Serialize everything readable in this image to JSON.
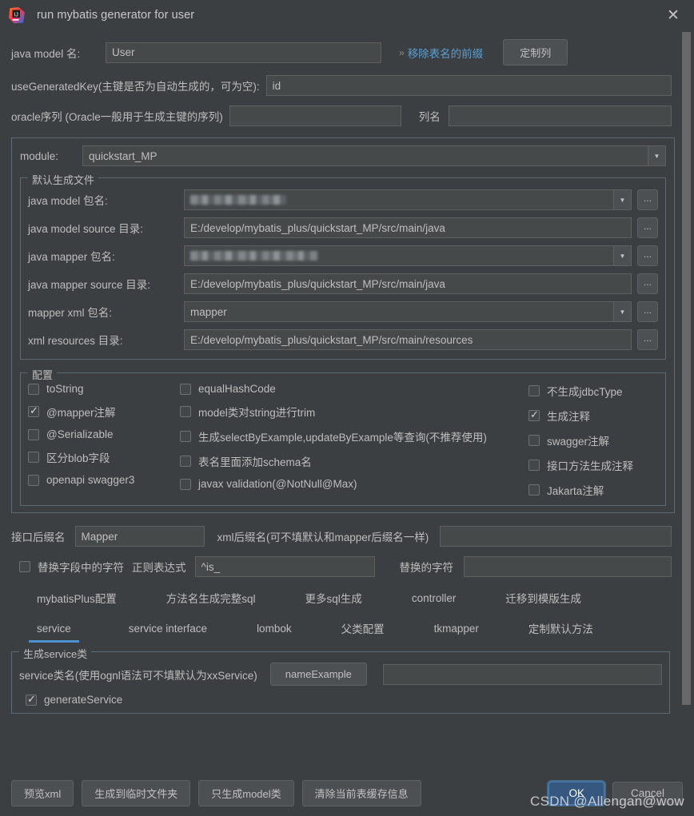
{
  "window": {
    "title": "run mybatis generator for user",
    "logo_icon": "intellij-idea-logo",
    "close_icon": "close-icon"
  },
  "form": {
    "java_model_label": "java model 名:",
    "java_model_value": "User",
    "remove_prefix_link": "移除表名的前缀",
    "chevron": "»",
    "custom_column_button": "定制列",
    "use_generated_key_label": "useGeneratedKey(主键是否为自动生成的，可为空):",
    "use_generated_key_value": "id",
    "oracle_seq_label": "oracle序列 (Oracle一般用于生成主键的序列)",
    "oracle_seq_value": "",
    "column_name_label": "列名",
    "column_name_value": "",
    "module_label": "module:",
    "module_value": "quickstart_MP"
  },
  "default_files_panel": {
    "title": "默认生成文件",
    "rows": [
      {
        "label": "java model 包名:",
        "value": "",
        "redacted": true,
        "type": "combo",
        "browse": "..."
      },
      {
        "label": "java model source 目录:",
        "value": "E:/develop/mybatis_plus/quickstart_MP/src/main/java",
        "redacted": false,
        "type": "text",
        "browse": "..."
      },
      {
        "label": "java mapper 包名:",
        "value": "",
        "redacted": true,
        "type": "combo",
        "browse": "..."
      },
      {
        "label": "java mapper source 目录:",
        "value": "E:/develop/mybatis_plus/quickstart_MP/src/main/java",
        "redacted": false,
        "type": "text",
        "browse": "..."
      },
      {
        "label": "mapper xml 包名:",
        "value": "mapper",
        "redacted": false,
        "type": "combo",
        "browse": "..."
      },
      {
        "label": "xml resources 目录:",
        "value": "E:/develop/mybatis_plus/quickstart_MP/src/main/resources",
        "redacted": false,
        "type": "text",
        "browse": "..."
      }
    ]
  },
  "config_panel": {
    "title": "配置",
    "column1": [
      {
        "label": "toString",
        "checked": false
      },
      {
        "label": "@mapper注解",
        "checked": true
      },
      {
        "label": "@Serializable",
        "checked": false
      },
      {
        "label": "区分blob字段",
        "checked": false
      },
      {
        "label": "openapi swagger3",
        "checked": false
      }
    ],
    "column2": [
      {
        "label": "equalHashCode",
        "checked": false
      },
      {
        "label": "model类对string进行trim",
        "checked": false
      },
      {
        "label": "生成selectByExample,updateByExample等查询(不推荐使用)",
        "checked": false
      },
      {
        "label": "表名里面添加schema名",
        "checked": false
      },
      {
        "label": "javax validation(@NotNull@Max)",
        "checked": false
      }
    ],
    "column3": [
      {
        "label": "不生成jdbcType",
        "checked": false
      },
      {
        "label": "生成注释",
        "checked": true
      },
      {
        "label": "swagger注解",
        "checked": false
      },
      {
        "label": "接口方法生成注释",
        "checked": false
      },
      {
        "label": "Jakarta注解",
        "checked": false
      }
    ]
  },
  "suffix": {
    "interface_suffix_label": "接口后缀名",
    "interface_suffix_value": "Mapper",
    "xml_suffix_label": "xml后缀名(可不填默认和mapper后缀名一样)",
    "xml_suffix_value": "",
    "replace_checkbox_label": "替换字段中的字符",
    "replace_checked": false,
    "regex_label": "正则表达式",
    "regex_value": "^is_",
    "replacement_label": "替换的字符",
    "replacement_value": ""
  },
  "tabs": {
    "row1": [
      {
        "label": "mybatisPlus配置",
        "active": false
      },
      {
        "label": "方法名生成完整sql",
        "active": false
      },
      {
        "label": "更多sql生成",
        "active": false
      },
      {
        "label": "controller",
        "active": false
      },
      {
        "label": "迁移到模版生成",
        "active": false
      }
    ],
    "row2": [
      {
        "label": "service",
        "active": true
      },
      {
        "label": "service interface",
        "active": false
      },
      {
        "label": "lombok",
        "active": false
      },
      {
        "label": "父类配置",
        "active": false
      },
      {
        "label": "tkmapper",
        "active": false
      },
      {
        "label": "定制默认方法",
        "active": false
      }
    ]
  },
  "service_panel": {
    "title": "生成service类",
    "class_name_label": "service类名(使用ognl语法可不填默认为xxService)",
    "name_example_button": "nameExample",
    "class_name_value": "",
    "generate_service_label": "generateService",
    "generate_service_checked": true
  },
  "footer": {
    "buttons": [
      "预览xml",
      "生成到临时文件夹",
      "只生成model类",
      "清除当前表缓存信息"
    ],
    "ok_label": "OK",
    "cancel_label": "Cancel"
  },
  "watermark": "CSDN @Allengan@wow"
}
